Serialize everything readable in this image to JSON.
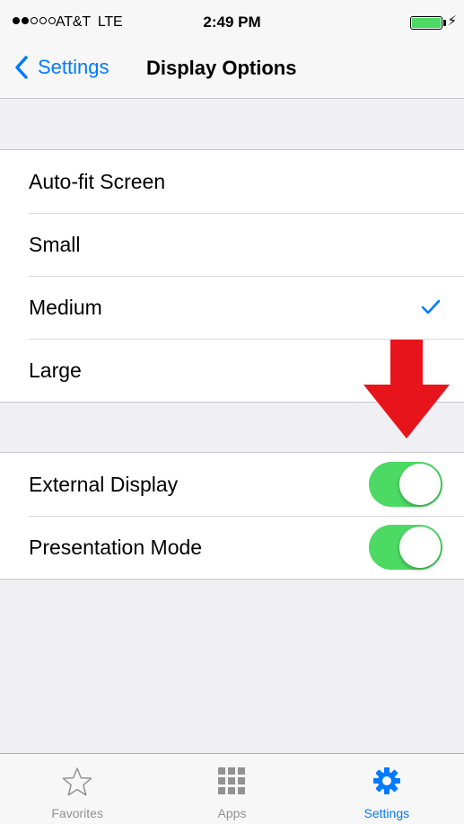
{
  "status_bar": {
    "carrier": "AT&T",
    "network": "LTE",
    "time": "2:49 PM",
    "signal_bars_filled": 2,
    "signal_bars_total": 5,
    "battery_level": 1.0
  },
  "nav": {
    "back_label": "Settings",
    "title": "Display Options"
  },
  "size_options": [
    {
      "label": "Auto-fit Screen",
      "selected": false
    },
    {
      "label": "Small",
      "selected": false
    },
    {
      "label": "Medium",
      "selected": true
    },
    {
      "label": "Large",
      "selected": false
    }
  ],
  "toggles": [
    {
      "label": "External Display",
      "on": true
    },
    {
      "label": "Presentation Mode",
      "on": true
    }
  ],
  "tabs": [
    {
      "label": "Favorites",
      "icon": "star-icon",
      "active": false
    },
    {
      "label": "Apps",
      "icon": "grid-icon",
      "active": false
    },
    {
      "label": "Settings",
      "icon": "gear-icon",
      "active": true
    }
  ],
  "colors": {
    "accent": "#007aff",
    "switch_on": "#4cd964",
    "annotation_arrow": "#e8141c",
    "background": "#efeff4"
  }
}
